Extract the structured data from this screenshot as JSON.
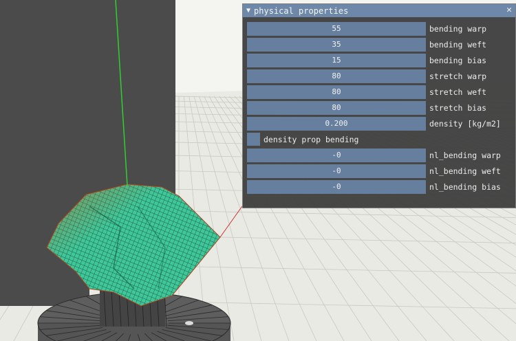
{
  "window": {
    "title": "physical properties",
    "collapse_icon": "triangle-down-icon",
    "close_icon": "close-icon"
  },
  "sliders": [
    {
      "value": "55",
      "label": "bending warp"
    },
    {
      "value": "35",
      "label": "bending weft"
    },
    {
      "value": "15",
      "label": "bending bias"
    },
    {
      "value": "80",
      "label": "stretch warp"
    },
    {
      "value": "80",
      "label": "stretch weft"
    },
    {
      "value": "80",
      "label": "stretch bias"
    },
    {
      "value": "0.200",
      "label": "density [kg/m2]"
    }
  ],
  "checkbox": {
    "label": "density prop bending",
    "checked": false
  },
  "nl_sliders": [
    {
      "value": "-0",
      "label": "nl_bending warp"
    },
    {
      "value": "-0",
      "label": "nl_bending weft"
    },
    {
      "value": "-0",
      "label": "nl_bending bias"
    }
  ],
  "colors": {
    "title_bar": "#6d88a8",
    "field": "#667f9f",
    "panel_bg": "#404040",
    "floor": "#ecece6",
    "cloth": "#3fc79a",
    "pedestal": "#5e5e5e"
  }
}
